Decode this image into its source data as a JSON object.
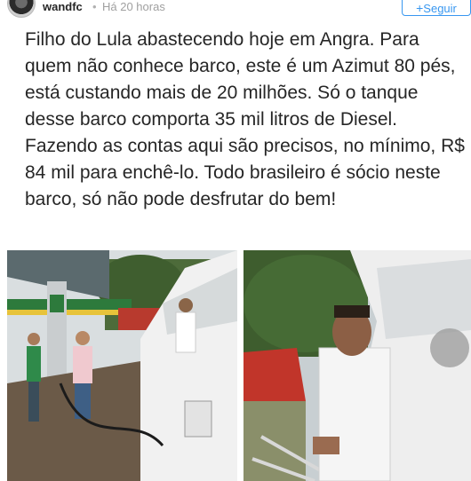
{
  "header": {
    "username": "wandfc",
    "separator": "•",
    "time": "Há 20 horas",
    "follow_label": "Seguir",
    "follow_icon": "plus-icon"
  },
  "post": {
    "caption": "Filho do Lula abastecendo hoje em Angra. Para quem não conhece barco, este é um Azimut 80 pés, está custando mais de 20 milhões. Só o tanque desse barco comporta 35 mil litros de Diesel. Fazendo as contas aqui são precisos, no mínimo, R$ 84 mil para enchê-lo. Todo brasileiro é sócio neste barco, só não pode desfrutar do bem!"
  },
  "colors": {
    "accent": "#3897f0",
    "text": "#262626",
    "muted": "#a0a0a0"
  }
}
